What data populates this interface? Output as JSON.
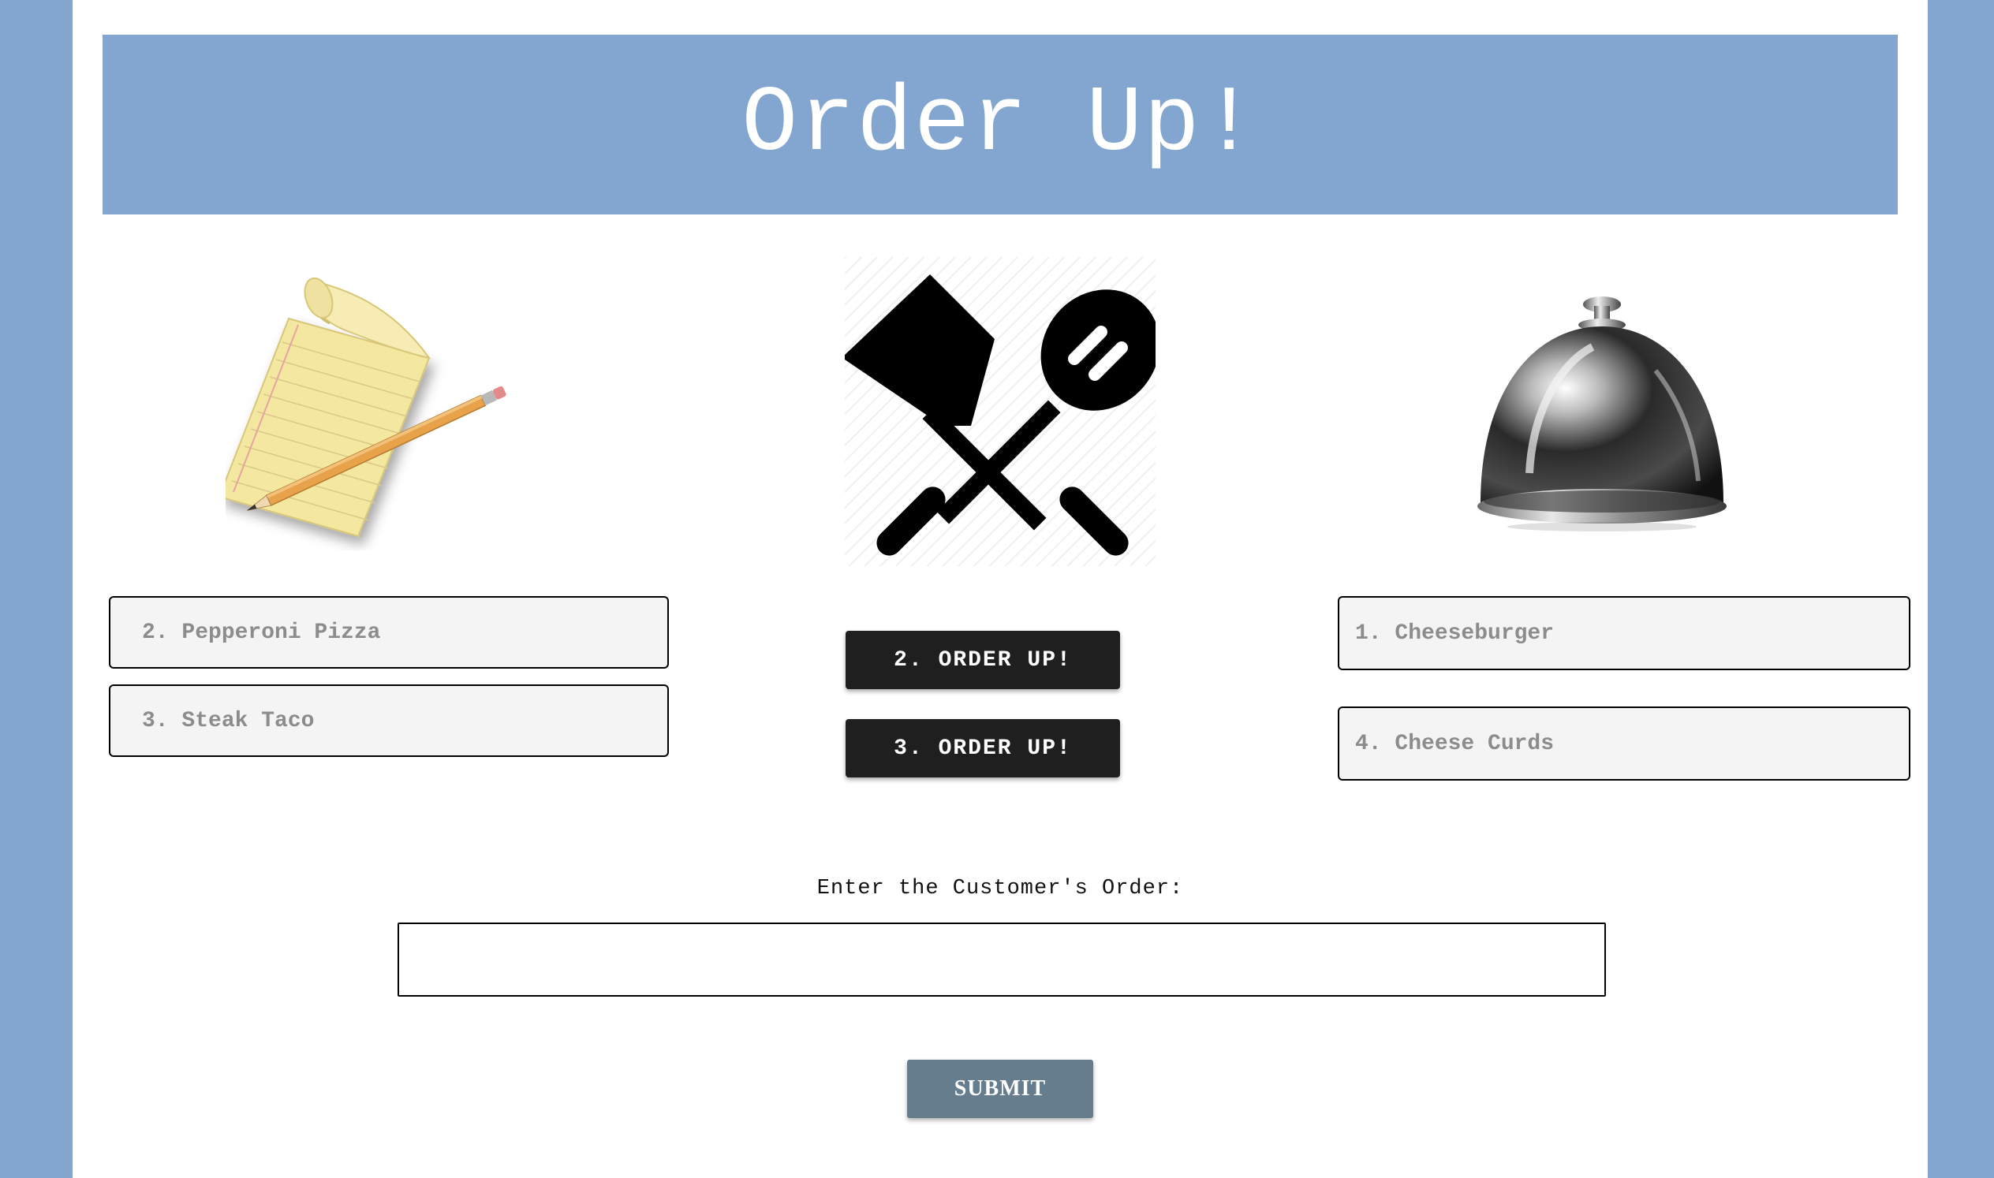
{
  "header": {
    "title": "Order Up!"
  },
  "pending_orders": [
    {
      "label": "2. Pepperoni Pizza"
    },
    {
      "label": "3. Steak Taco"
    }
  ],
  "kitchen_buttons": [
    {
      "label": "2. ORDER UP!"
    },
    {
      "label": "3. ORDER UP!"
    }
  ],
  "served_orders": [
    {
      "label": "1. Cheeseburger"
    },
    {
      "label": "4. Cheese Curds"
    }
  ],
  "form": {
    "prompt": "Enter the Customer's Order:",
    "input_value": "",
    "submit_label": "SUBMIT"
  },
  "icons": {
    "left": "notepad-pencil-icon",
    "center": "spatula-utensils-icon",
    "right": "serving-cloche-icon"
  },
  "colors": {
    "background": "#83a6d0",
    "header": "#83a6d0",
    "order_button": "#1f1f1f",
    "submit_button": "#667d8e"
  }
}
